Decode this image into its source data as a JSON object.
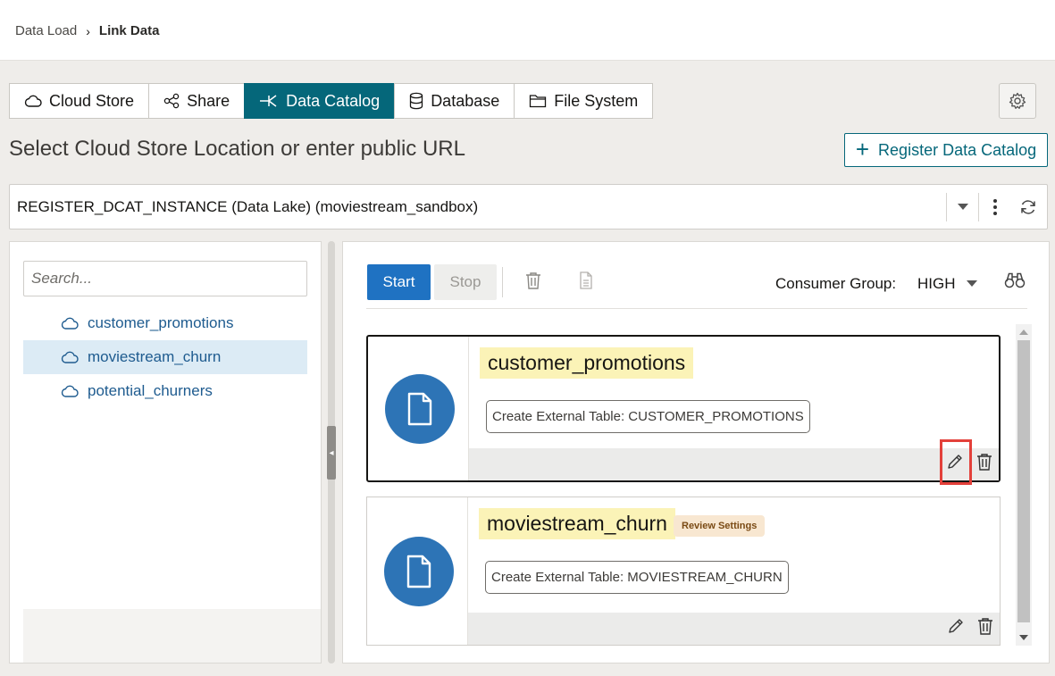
{
  "breadcrumb": {
    "parent": "Data Load",
    "current": "Link Data"
  },
  "tabs": [
    {
      "label": "Cloud Store",
      "icon": "cloud-icon"
    },
    {
      "label": "Share",
      "icon": "share-icon"
    },
    {
      "label": "Data Catalog",
      "icon": "data-catalog-icon",
      "active": true
    },
    {
      "label": "Database",
      "icon": "database-icon"
    },
    {
      "label": "File System",
      "icon": "folder-icon"
    }
  ],
  "section_title": "Select Cloud Store Location or enter public URL",
  "register_button": "Register Data Catalog",
  "location": {
    "value": "REGISTER_DCAT_INSTANCE (Data Lake) (moviestream_sandbox)"
  },
  "left": {
    "search_placeholder": "Search...",
    "items": [
      {
        "label": "customer_promotions"
      },
      {
        "label": "moviestream_churn",
        "selected": true
      },
      {
        "label": "potential_churners"
      }
    ]
  },
  "toolbar": {
    "start": "Start",
    "stop": "Stop",
    "consumer_label": "Consumer Group:",
    "consumer_value": "HIGH"
  },
  "cards": [
    {
      "name": "customer_promotions",
      "action": "Create External Table: CUSTOMER_PROMOTIONS"
    },
    {
      "name": "moviestream_churn",
      "badge": "Review Settings",
      "action": "Create External Table: MOVIESTREAM_CHURN"
    }
  ],
  "colors": {
    "accent_teal": "#05677a",
    "primary_blue": "#1f72c2",
    "doc_circle": "#2d74b6",
    "highlight_red": "#e3403a",
    "name_highlight": "#fbf3b7"
  }
}
